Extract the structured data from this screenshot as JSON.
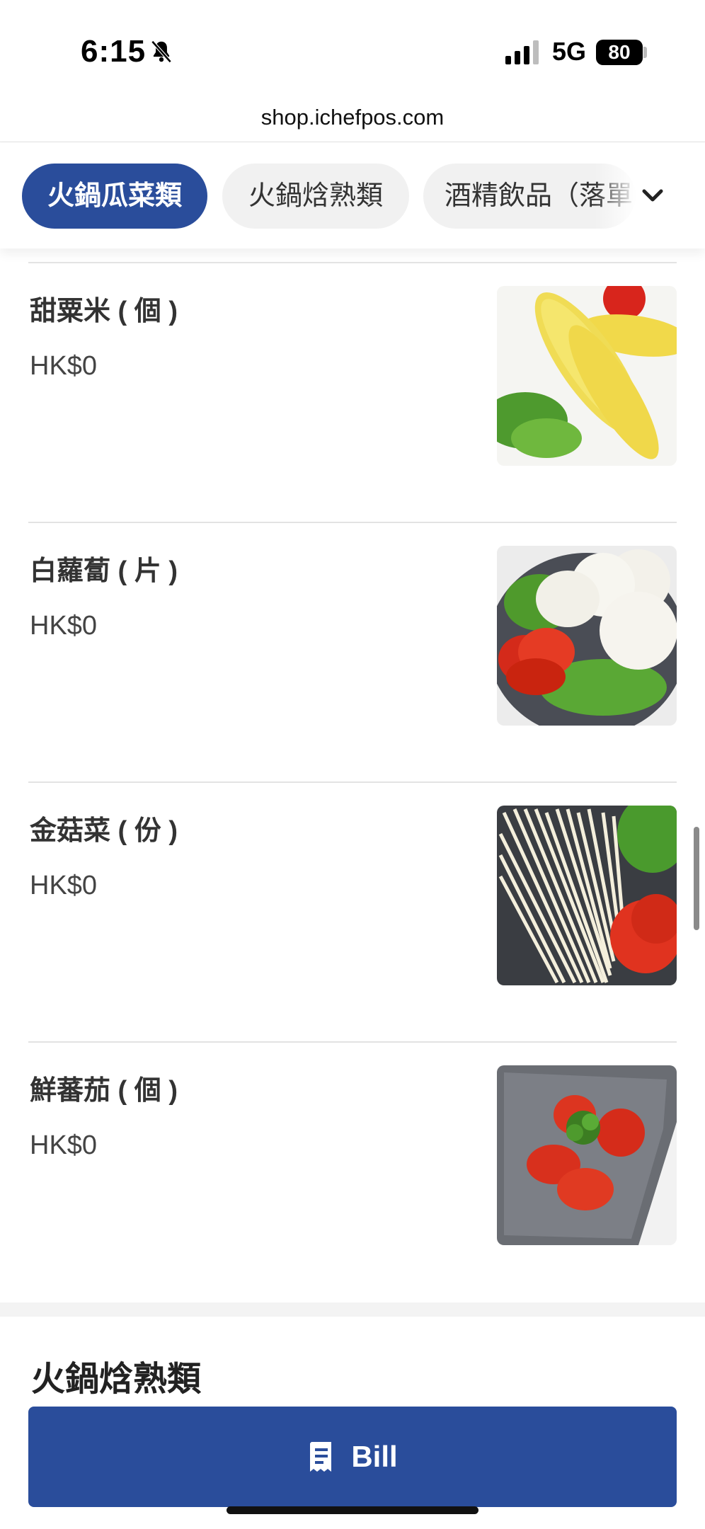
{
  "status_bar": {
    "time": "6:15",
    "network": "5G",
    "battery": "80"
  },
  "browser": {
    "url": "shop.ichefpos.com"
  },
  "categories": [
    {
      "label": "火鍋瓜菜類",
      "active": true
    },
    {
      "label": "火鍋焓熟類",
      "active": false
    },
    {
      "label": "酒精飲品（落單",
      "active": false
    }
  ],
  "items": [
    {
      "name": "甜粟米 ( 個 )",
      "price": "HK$0"
    },
    {
      "name": "白蘿蔔 ( 片 )",
      "price": "HK$0"
    },
    {
      "name": "金菇菜 ( 份 )",
      "price": "HK$0"
    },
    {
      "name": "鮮蕃茄 ( 個 )",
      "price": "HK$0"
    }
  ],
  "next_section": {
    "title": "火鍋焓熟類"
  },
  "bill_button": {
    "label": "Bill"
  },
  "colors": {
    "accent": "#2a4d9b"
  }
}
